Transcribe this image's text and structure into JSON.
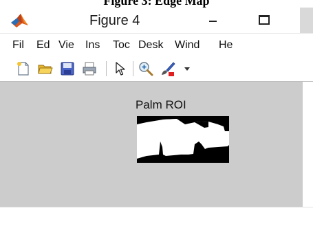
{
  "caption": "Figure 3: Edge Map",
  "window": {
    "title": "Figure 4"
  },
  "menu": {
    "items": [
      "Fil",
      "Ed",
      "Vie",
      "Ins",
      "Toc",
      "Desk",
      "Wind",
      "He"
    ]
  },
  "toolbar": {
    "icons": [
      "new-figure-icon",
      "open-file-icon",
      "save-icon",
      "print-icon",
      "pointer-icon",
      "zoom-in-icon",
      "brush-icon"
    ]
  },
  "plot": {
    "title": "Palm ROI"
  },
  "colors": {
    "canvas": "#cccccc",
    "window": "#ffffff",
    "image_foreground": "#ffffff",
    "image_background": "#000000"
  }
}
